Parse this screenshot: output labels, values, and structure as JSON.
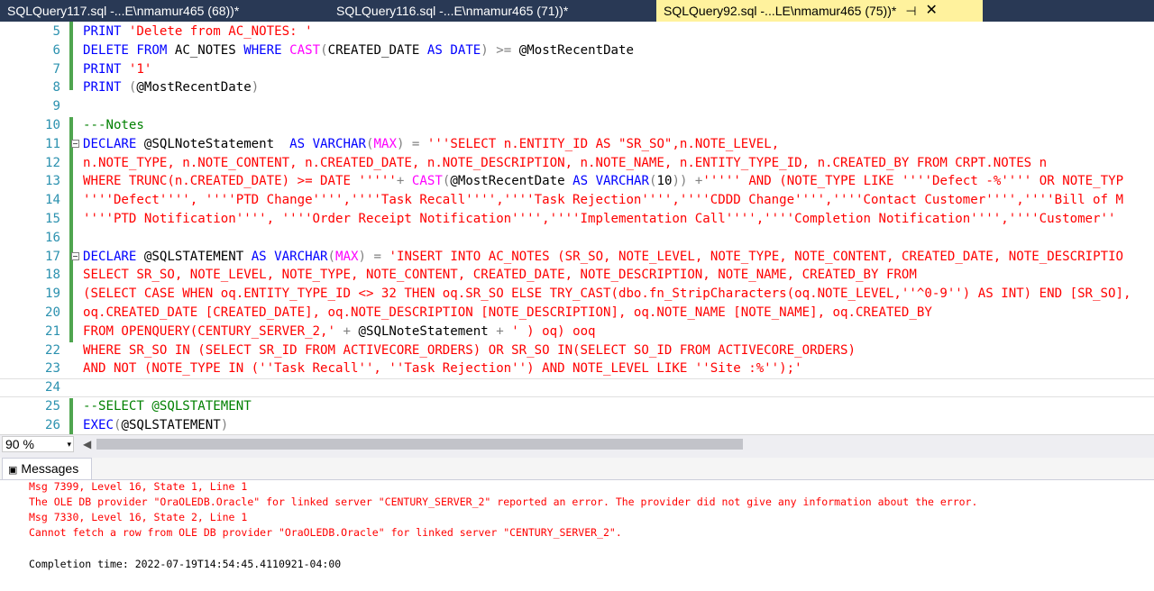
{
  "tabs": [
    {
      "label": "SQLQuery117.sql -...E\\nmamur465 (68))*"
    },
    {
      "label": "SQLQuery116.sql -...E\\nmamur465 (71))*"
    },
    {
      "label": "SQLQuery92.sql -...LE\\nmamur465 (75))*",
      "pin": "⊣",
      "close": "✕"
    }
  ],
  "editor": {
    "line_numbers": [
      "5",
      "6",
      "7",
      "8",
      "9",
      "10",
      "11",
      "12",
      "13",
      "14",
      "15",
      "16",
      "17",
      "18",
      "19",
      "20",
      "21",
      "22",
      "23",
      "24",
      "25",
      "26"
    ],
    "lines": [
      [
        {
          "t": "PRINT ",
          "c": "kw"
        },
        {
          "t": "'Delete from AC_NOTES: '",
          "c": "st"
        }
      ],
      [
        {
          "t": "DELETE FROM ",
          "c": "kw"
        },
        {
          "t": "AC_NOTES ",
          "c": "tx"
        },
        {
          "t": "WHERE ",
          "c": "kw"
        },
        {
          "t": "CAST",
          "c": "fn"
        },
        {
          "t": "(",
          "c": "gy"
        },
        {
          "t": "CREATED_DATE ",
          "c": "tx"
        },
        {
          "t": "AS DATE",
          "c": "kw"
        },
        {
          "t": ") >= ",
          "c": "gy"
        },
        {
          "t": "@MostRecentDate",
          "c": "tx"
        }
      ],
      [
        {
          "t": "PRINT ",
          "c": "kw"
        },
        {
          "t": "'1'",
          "c": "st"
        }
      ],
      [
        {
          "t": "PRINT ",
          "c": "kw"
        },
        {
          "t": "(",
          "c": "gy"
        },
        {
          "t": "@MostRecentDate",
          "c": "tx"
        },
        {
          "t": ")",
          "c": "gy"
        }
      ],
      [],
      [
        {
          "t": "---Notes",
          "c": "cm"
        }
      ],
      [
        {
          "t": "DECLARE ",
          "c": "kw"
        },
        {
          "t": "@SQLNoteStatement  ",
          "c": "tx"
        },
        {
          "t": "AS VARCHAR",
          "c": "kw"
        },
        {
          "t": "(",
          "c": "gy"
        },
        {
          "t": "MAX",
          "c": "fn"
        },
        {
          "t": ") = ",
          "c": "gy"
        },
        {
          "t": "'''SELECT n.ENTITY_ID AS \"SR_SO\",n.NOTE_LEVEL,",
          "c": "st"
        }
      ],
      [
        {
          "t": "n.NOTE_TYPE, n.NOTE_CONTENT, n.CREATED_DATE, n.NOTE_DESCRIPTION, n.NOTE_NAME, n.ENTITY_TYPE_ID, n.CREATED_BY FROM CRPT.NOTES n",
          "c": "st"
        }
      ],
      [
        {
          "t": "WHERE TRUNC(n.CREATED_DATE) >= DATE '''''",
          "c": "st"
        },
        {
          "t": "+ ",
          "c": "gy"
        },
        {
          "t": "CAST",
          "c": "fn"
        },
        {
          "t": "(",
          "c": "gy"
        },
        {
          "t": "@MostRecentDate ",
          "c": "tx"
        },
        {
          "t": "AS VARCHAR",
          "c": "kw"
        },
        {
          "t": "(",
          "c": "gy"
        },
        {
          "t": "10",
          "c": "tx"
        },
        {
          "t": ")) +",
          "c": "gy"
        },
        {
          "t": "''''' AND (NOTE_TYPE LIKE ''''Defect -%'''' OR NOTE_TYP",
          "c": "st"
        }
      ],
      [
        {
          "t": "''''Defect'''', ''''PTD Change'''',''''Task Recall'''',''''Task Rejection'''',''''CDDD Change'''',''''Contact Customer'''',''''Bill of M",
          "c": "st"
        }
      ],
      [
        {
          "t": "''''PTD Notification'''', ''''Order Receipt Notification'''',''''Implementation Call'''',''''Completion Notification'''',''''Customer''",
          "c": "st"
        }
      ],
      [],
      [
        {
          "t": "DECLARE ",
          "c": "kw"
        },
        {
          "t": "@SQLSTATEMENT ",
          "c": "tx"
        },
        {
          "t": "AS VARCHAR",
          "c": "kw"
        },
        {
          "t": "(",
          "c": "gy"
        },
        {
          "t": "MAX",
          "c": "fn"
        },
        {
          "t": ") = ",
          "c": "gy"
        },
        {
          "t": "'INSERT INTO AC_NOTES (SR_SO, NOTE_LEVEL, NOTE_TYPE, NOTE_CONTENT, CREATED_DATE, NOTE_DESCRIPTIO",
          "c": "st"
        }
      ],
      [
        {
          "t": "SELECT SR_SO, NOTE_LEVEL, NOTE_TYPE, NOTE_CONTENT, CREATED_DATE, NOTE_DESCRIPTION, NOTE_NAME, CREATED_BY FROM",
          "c": "st"
        }
      ],
      [
        {
          "t": "(SELECT CASE WHEN oq.ENTITY_TYPE_ID <> 32 THEN oq.SR_SO ELSE TRY_CAST(dbo.fn_StripCharacters(oq.NOTE_LEVEL,''^0-9'') AS INT) END [SR_SO],",
          "c": "st"
        }
      ],
      [
        {
          "t": "oq.CREATED_DATE [CREATED_DATE], oq.NOTE_DESCRIPTION [NOTE_DESCRIPTION], oq.NOTE_NAME [NOTE_NAME], oq.CREATED_BY",
          "c": "st"
        }
      ],
      [
        {
          "t": "FROM OPENQUERY(CENTURY_SERVER_2,' ",
          "c": "st"
        },
        {
          "t": "+ ",
          "c": "gy"
        },
        {
          "t": "@SQLNoteStatement ",
          "c": "tx"
        },
        {
          "t": "+ ",
          "c": "gy"
        },
        {
          "t": "' ) oq) ooq",
          "c": "st"
        }
      ],
      [
        {
          "t": "WHERE SR_SO IN (SELECT SR_ID FROM ACTIVECORE_ORDERS) OR SR_SO IN(SELECT SO_ID FROM ACTIVECORE_ORDERS)",
          "c": "st"
        }
      ],
      [
        {
          "t": "AND NOT (NOTE_TYPE IN (''Task Recall'', ''Task Rejection'') AND NOTE_LEVEL LIKE ''Site :%'');'",
          "c": "st"
        }
      ],
      [],
      [
        {
          "t": "--SELECT @SQLSTATEMENT",
          "c": "cm"
        }
      ],
      [
        {
          "t": "EXEC",
          "c": "kw"
        },
        {
          "t": "(",
          "c": "gy"
        },
        {
          "t": "@SQLSTATEMENT",
          "c": "tx"
        },
        {
          "t": ")",
          "c": "gy"
        }
      ]
    ]
  },
  "status": {
    "zoom": "90 %",
    "dropdown_icon": "▾",
    "scroll_left_icon": "◀"
  },
  "messages": {
    "tab_label": "Messages",
    "tab_icon": "▣",
    "lines": [
      "Msg 7399, Level 16, State 1, Line 1",
      "The OLE DB provider \"OraOLEDB.Oracle\" for linked server \"CENTURY_SERVER_2\" reported an error. The provider did not give any information about the error.",
      "Msg 7330, Level 16, State 2, Line 1",
      "Cannot fetch a row from OLE DB provider \"OraOLEDB.Oracle\" for linked server \"CENTURY_SERVER_2\"."
    ],
    "completion": "Completion time: 2022-07-19T14:54:45.4110921-04:00"
  }
}
